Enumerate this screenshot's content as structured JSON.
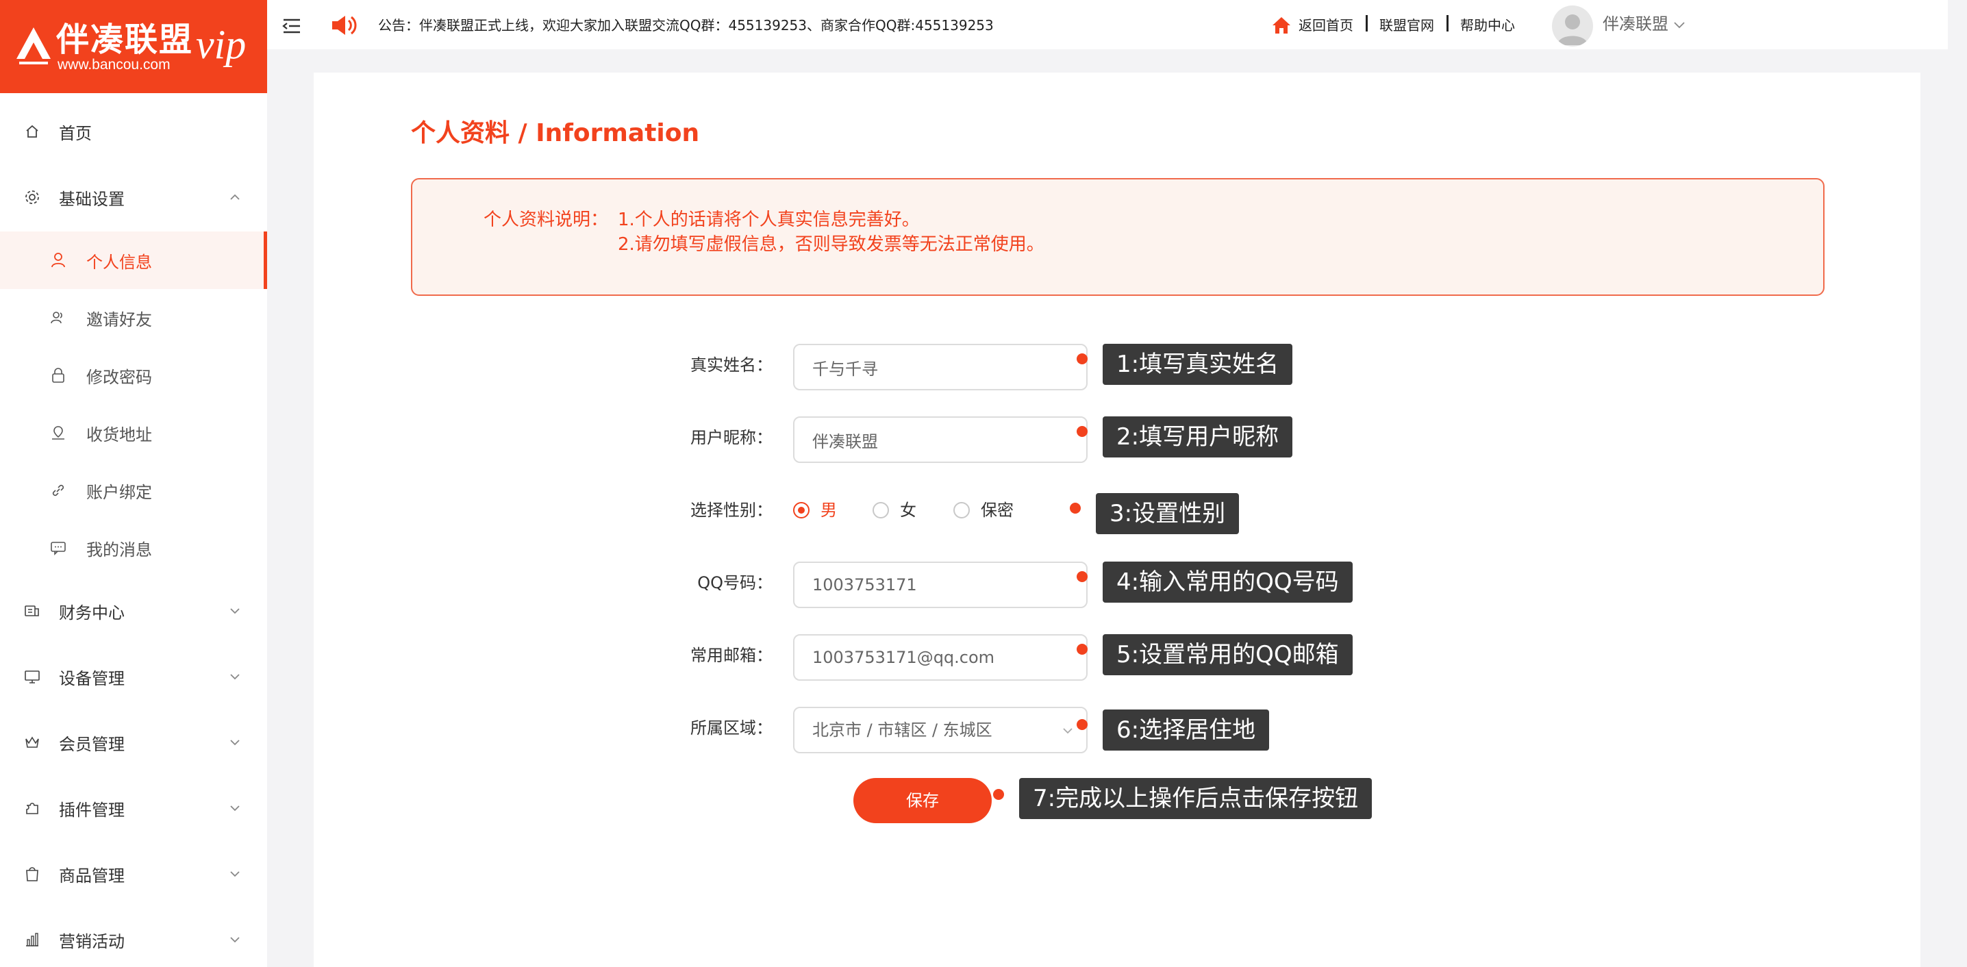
{
  "brand": {
    "name": "伴凑联盟",
    "domain": "www.bancou.com",
    "vip": "vip",
    "color": "#f2421d"
  },
  "topbar": {
    "collapse_icon": "menu-collapse-icon",
    "notice_icon": "speaker-icon",
    "notice": "公告：伴凑联盟正式上线，欢迎大家加入联盟交流QQ群：455139253、商家合作QQ群:455139253",
    "links": [
      "返回首页",
      "联盟官网",
      "帮助中心"
    ],
    "user_name": "伴凑联盟"
  },
  "sidebar": {
    "items": [
      {
        "label": "首页",
        "icon": "home-icon"
      },
      {
        "label": "基础设置",
        "icon": "gear-icon",
        "expanded": true
      },
      {
        "label": "个人信息",
        "icon": "user-icon",
        "active": true
      },
      {
        "label": "邀请好友",
        "icon": "invite-friends-icon"
      },
      {
        "label": "修改密码",
        "icon": "lock-icon"
      },
      {
        "label": "收货地址",
        "icon": "location-icon"
      },
      {
        "label": "账户绑定",
        "icon": "link-icon"
      },
      {
        "label": "我的消息",
        "icon": "message-icon"
      },
      {
        "label": "财务中心",
        "icon": "finance-icon"
      },
      {
        "label": "设备管理",
        "icon": "monitor-icon"
      },
      {
        "label": "会员管理",
        "icon": "crown-icon"
      },
      {
        "label": "插件管理",
        "icon": "puzzle-icon"
      },
      {
        "label": "商品管理",
        "icon": "shopping-bag-icon"
      },
      {
        "label": "营销活动",
        "icon": "bar-chart-icon"
      }
    ]
  },
  "page": {
    "title": "个人资料 / Information",
    "notice_label": "个人资料说明：",
    "notice_lines": [
      "1.个人的话请将个人真实信息完善好。",
      "2.请勿填写虚假信息，否则导致发票等无法正常使用。"
    ]
  },
  "form": {
    "real_name": {
      "label": "真实姓名：",
      "value": "千与千寻"
    },
    "nickname": {
      "label": "用户昵称：",
      "value": "伴凑联盟"
    },
    "gender": {
      "label": "选择性别：",
      "options": [
        "男",
        "女",
        "保密"
      ],
      "selected": "男"
    },
    "qq": {
      "label": "QQ号码：",
      "value": "1003753171"
    },
    "email": {
      "label": "常用邮箱：",
      "value": "1003753171@qq.com"
    },
    "region": {
      "label": "所属区域：",
      "value": "北京市 / 市辖区 / 东城区"
    },
    "save_label": "保存"
  },
  "callouts": [
    "1:填写真实姓名",
    "2:填写用户昵称",
    "3:设置性别",
    "4:输入常用的QQ号码",
    "5:设置常用的QQ邮箱",
    "6:选择居住地",
    "7:完成以上操作后点击保存按钮"
  ]
}
